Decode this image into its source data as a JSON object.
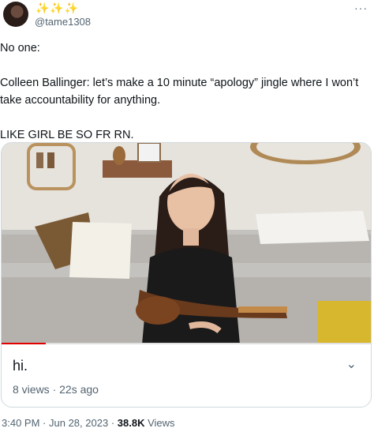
{
  "header": {
    "sparkles": "✨✨✨",
    "handle": "@tame1308",
    "more_icon": "more-horizontal-icon"
  },
  "tweet": {
    "line1": "No one:",
    "line2": "Colleen Ballinger: let’s make a 10 minute “apology” jingle where I won’t take accountability for anything.",
    "line3": "LIKE GIRL BE SO FR RN."
  },
  "media": {
    "caption": "hi.",
    "views": "8 views",
    "age": "22s ago",
    "progress": 0.12
  },
  "footer": {
    "time": "3:40 PM",
    "date": "Jun 28, 2023",
    "views_count": "38.8K",
    "views_label": "Views"
  }
}
